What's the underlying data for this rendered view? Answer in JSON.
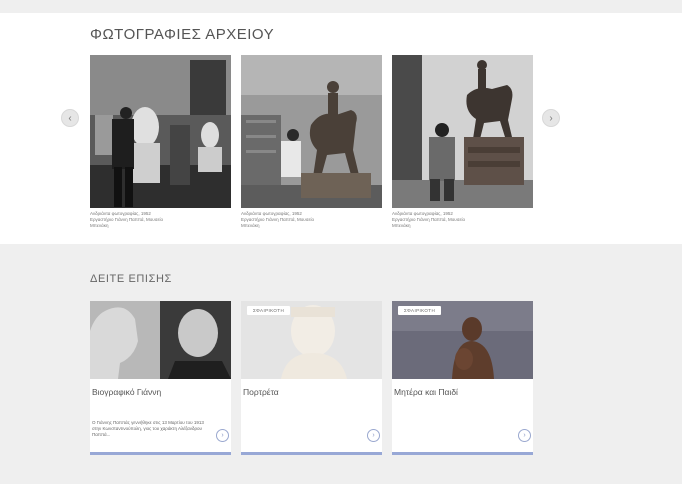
{
  "archive": {
    "title": "ΦΩΤΟΓΡΑΦΙΕΣ ΑΡΧΕΙΟΥ",
    "prev_icon": "‹",
    "next_icon": "›",
    "photos": [
      {
        "caption_1": "Ανδριάντα φωτογραφίας, 1952",
        "caption_2": "Εργαστήριο Γιάννη Παππά, Μουσείο",
        "caption_3": "Μπενάκη"
      },
      {
        "caption_1": "Ανδριάντα φωτογραφίας, 1952",
        "caption_2": "Εργαστήριο Γιάννη Παππά, Μουσείο",
        "caption_3": "Μπενάκη"
      },
      {
        "caption_1": "Ανδριάντα φωτογραφίας, 1952",
        "caption_2": "Εργαστήριο Γιάννη Παππά, Μουσείο",
        "caption_3": "Μπενάκη"
      }
    ]
  },
  "see_also": {
    "title": "ΔΕΙΤΕ ΕΠΙΣΗΣ",
    "cards": [
      {
        "badge": "",
        "title": "Βιογραφικό Γιάννη",
        "excerpt": "Ο Γιάννης Παππάς γεννήθηκε στις 13 Μαρτίου του 1913 στην Κωνσταντινούπολη, γιος του χαράκτη Αλέξανδρου Παππά...",
        "arrow": "›"
      },
      {
        "badge": "ΣΦΑΙΡΙΚΟΤΗ",
        "title": "Πορτρέτα",
        "excerpt": "",
        "arrow": "›"
      },
      {
        "badge": "ΣΦΑΙΡΙΚΟΤΗ",
        "title": "Μητέρα και Παιδί",
        "excerpt": "",
        "arrow": "›"
      }
    ]
  }
}
